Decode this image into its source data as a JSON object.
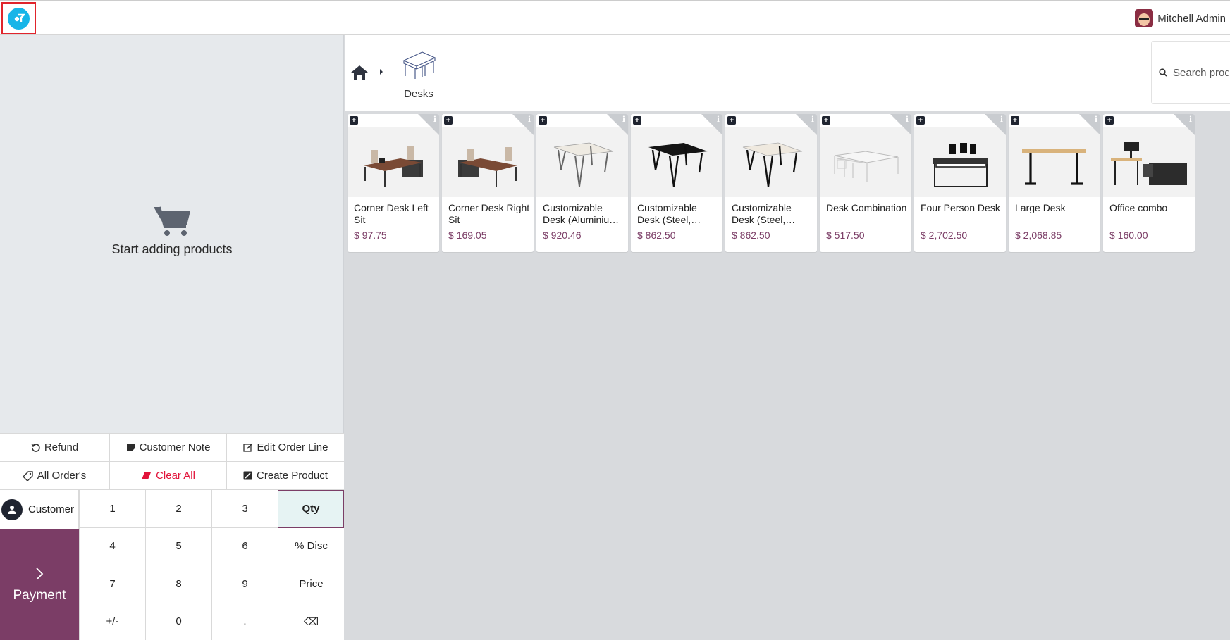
{
  "user": {
    "name": "Mitchell Admin"
  },
  "order": {
    "empty_text": "Start adding products"
  },
  "actions": {
    "row1": [
      {
        "label": "Refund",
        "icon": "undo-icon"
      },
      {
        "label": "Customer Note",
        "icon": "note-icon"
      },
      {
        "label": "Edit Order Line",
        "icon": "edit-icon"
      }
    ],
    "row2": [
      {
        "label": "All Order's",
        "icon": "tag-icon"
      },
      {
        "label": "Clear All",
        "icon": "eraser-icon",
        "color": "#e2143b"
      },
      {
        "label": "Create Product",
        "icon": "create-icon"
      }
    ]
  },
  "customer": {
    "label": "Customer"
  },
  "payment": {
    "label": "Payment"
  },
  "numpad": [
    "1",
    "2",
    "3",
    "Qty",
    "4",
    "5",
    "6",
    "% Disc",
    "7",
    "8",
    "9",
    "Price",
    "+/-",
    "0",
    ".",
    "⌫"
  ],
  "numpad_active": "Qty",
  "breadcrumb": {
    "category": "Desks"
  },
  "search": {
    "placeholder": "Search products..."
  },
  "products": [
    {
      "name": "Corner Desk Left Sit",
      "price": "$ 97.75",
      "icon": "corner-desk-icon"
    },
    {
      "name": "Corner Desk Right Sit",
      "price": "$ 169.05",
      "icon": "corner-desk-icon"
    },
    {
      "name": "Customizable Desk (Aluminium, White)",
      "price": "$ 920.46",
      "icon": "white-desk-icon"
    },
    {
      "name": "Customizable Desk (Steel, Black)",
      "price": "$ 862.50",
      "icon": "black-desk-icon"
    },
    {
      "name": "Customizable Desk (Steel, White)",
      "price": "$ 862.50",
      "icon": "white-desk-icon"
    },
    {
      "name": "Desk Combination",
      "price": "$ 517.50",
      "icon": "desk-combination-icon"
    },
    {
      "name": "Four Person Desk",
      "price": "$ 2,702.50",
      "icon": "four-person-desk-icon"
    },
    {
      "name": "Large Desk",
      "price": "$ 2,068.85",
      "icon": "large-desk-icon"
    },
    {
      "name": "Office combo",
      "price": "$ 160.00",
      "icon": "office-combo-icon"
    }
  ],
  "colors": {
    "accent": "#7b3d66",
    "danger": "#e2143b",
    "logo": "#17b5e8",
    "active_key_bg": "#e6f3f3"
  }
}
